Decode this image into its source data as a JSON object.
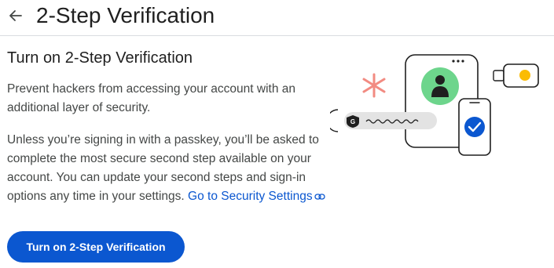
{
  "header": {
    "back_icon": "arrow-back-icon",
    "title": "2-Step Verification"
  },
  "main": {
    "section_title": "Turn on 2-Step Verification",
    "intro": "Prevent hackers from accessing your account with an additional layer of security.",
    "body_text": "Unless you’re signing in with a passkey, you’ll be asked to complete the most secure second step available on your account. You can update your second steps and sign-in options any time in your settings.",
    "security_link": "Go to Security Settings",
    "link_icon": "link-icon",
    "primary_button": "Turn on 2-Step Verification"
  },
  "illustration": {
    "password_badge_letter": "G",
    "icons": [
      "asterisk-icon",
      "phone-icon",
      "person-avatar-icon",
      "checkmark-icon",
      "security-key-icon"
    ],
    "colors": {
      "accent_blue": "#0b57d0",
      "avatar_green": "#6dd58c",
      "asterisk_red": "#f28b82",
      "key_yellow": "#fbbc04",
      "pill_gray": "#e3e3e3"
    }
  }
}
